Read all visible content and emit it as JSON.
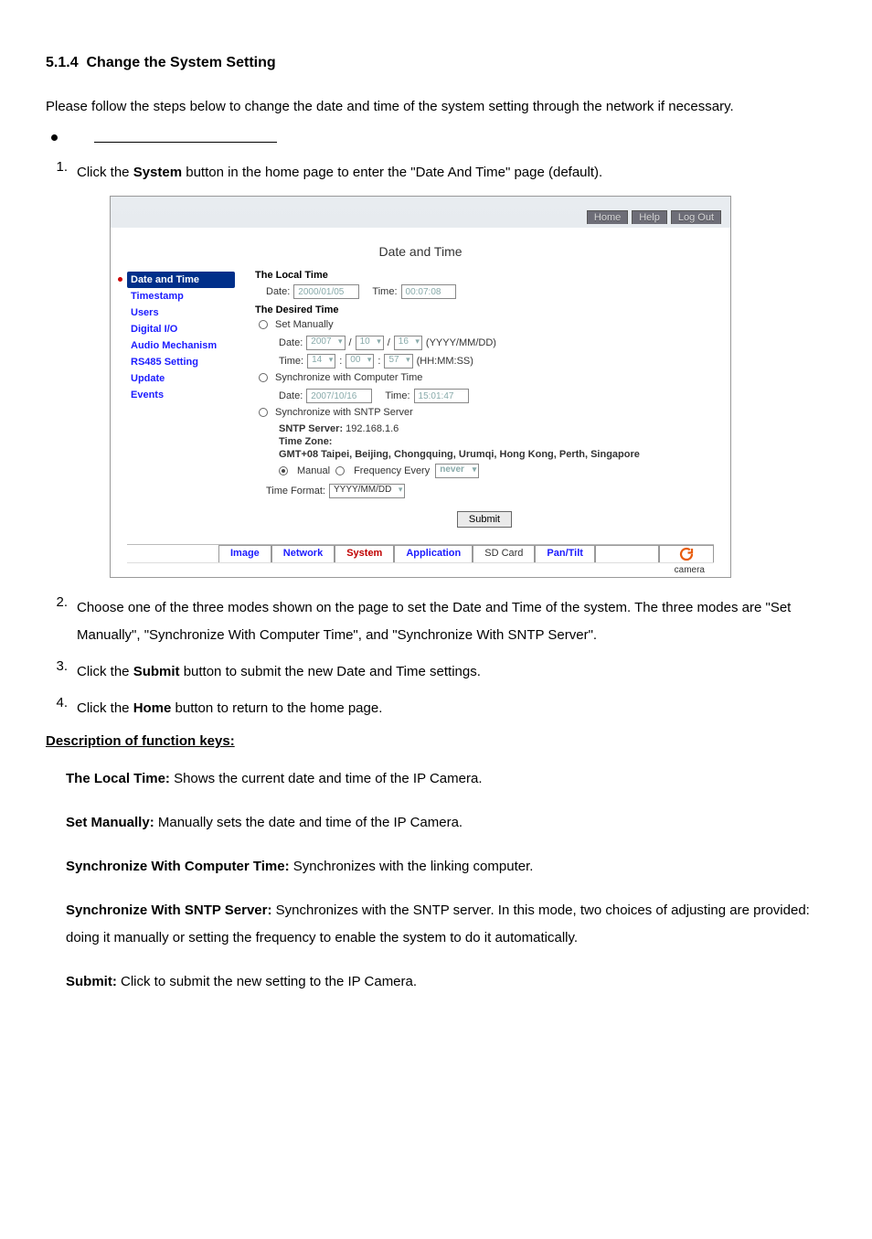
{
  "section": {
    "number": "5.1.4",
    "title": "Change the System Setting",
    "intro": "Please follow the steps below to change the date and time of the system setting through the network if necessary."
  },
  "steps": {
    "s1_pre": "Click the ",
    "s1_bold": "System",
    "s1_post": " button in the home page to enter the \"Date And Time\" page (default).",
    "s2": "Choose one of the three modes shown on the page to set the Date and Time of the system. The three modes are \"Set Manually\", \"Synchronize With Computer Time\", and \"Synchronize With SNTP Server\".",
    "s3_pre": "Click the ",
    "s3_bold": "Submit",
    "s3_post": " button to submit the new Date and Time settings.",
    "s4_pre": "Click the ",
    "s4_bold": "Home",
    "s4_post": " button to return to the home page."
  },
  "desc": {
    "heading": "Description of function keys:",
    "items": [
      {
        "k": "The Local Time:",
        "v": " Shows the current date and time of the IP Camera."
      },
      {
        "k": "Set Manually:",
        "v": " Manually sets the date and time of the IP Camera."
      },
      {
        "k": "Synchronize With Computer Time:",
        "v": " Synchronizes with the linking computer."
      },
      {
        "k": "Synchronize With SNTP Server:",
        "v": " Synchronizes with the SNTP server. In this mode, two choices of adjusting are provided: doing it manually or setting the frequency to enable the system to do it automatically."
      },
      {
        "k": "Submit:",
        "v": " Click to submit the new setting to the IP Camera."
      }
    ]
  },
  "shot": {
    "top": {
      "home": "Home",
      "help": "Help",
      "logout": "Log Out"
    },
    "heading": "Date and Time",
    "nav": [
      "Date and Time",
      "Timestamp",
      "Users",
      "Digital I/O",
      "Audio Mechanism",
      "RS485 Setting",
      "Update",
      "Events"
    ],
    "local": {
      "title": "The Local Time",
      "date_lbl": "Date:",
      "date_val": "2000/01/05",
      "time_lbl": "Time:",
      "time_val": "00:07:08"
    },
    "desired": {
      "title": "The Desired Time",
      "set_manually": "Set Manually",
      "m_date_lbl": "Date:",
      "m_year": "2007",
      "m_mon": "10",
      "m_day": "16",
      "m_hint": "(YYYY/MM/DD)",
      "m_time_lbl": "Time:",
      "m_hh": "14",
      "m_mm": "00",
      "m_ss": "57",
      "m_thint": "(HH:MM:SS)",
      "sync_comp": "Synchronize with Computer Time",
      "c_date_lbl": "Date:",
      "c_date": "2007/10/16",
      "c_time_lbl": "Time:",
      "c_time": "15:01:47",
      "sync_sntp": "Synchronize with SNTP Server",
      "sntp_server_lbl": "SNTP Server:",
      "sntp_server": "192.168.1.6",
      "tz_lbl": "Time Zone:",
      "tz": "GMT+08 Taipei, Beijing, Chongquing, Urumqi, Hong Kong, Perth, Singapore",
      "manual": "Manual",
      "freq_lbl": "Frequency Every",
      "freq": "never",
      "tf_lbl": "Time Format:",
      "tf": "YYYY/MM/DD"
    },
    "submit": "Submit",
    "tabs": {
      "image": "Image",
      "network": "Network",
      "system": "System",
      "application": "Application",
      "sd": "SD Card",
      "pt": "Pan/Tilt"
    },
    "footer": "camera"
  }
}
